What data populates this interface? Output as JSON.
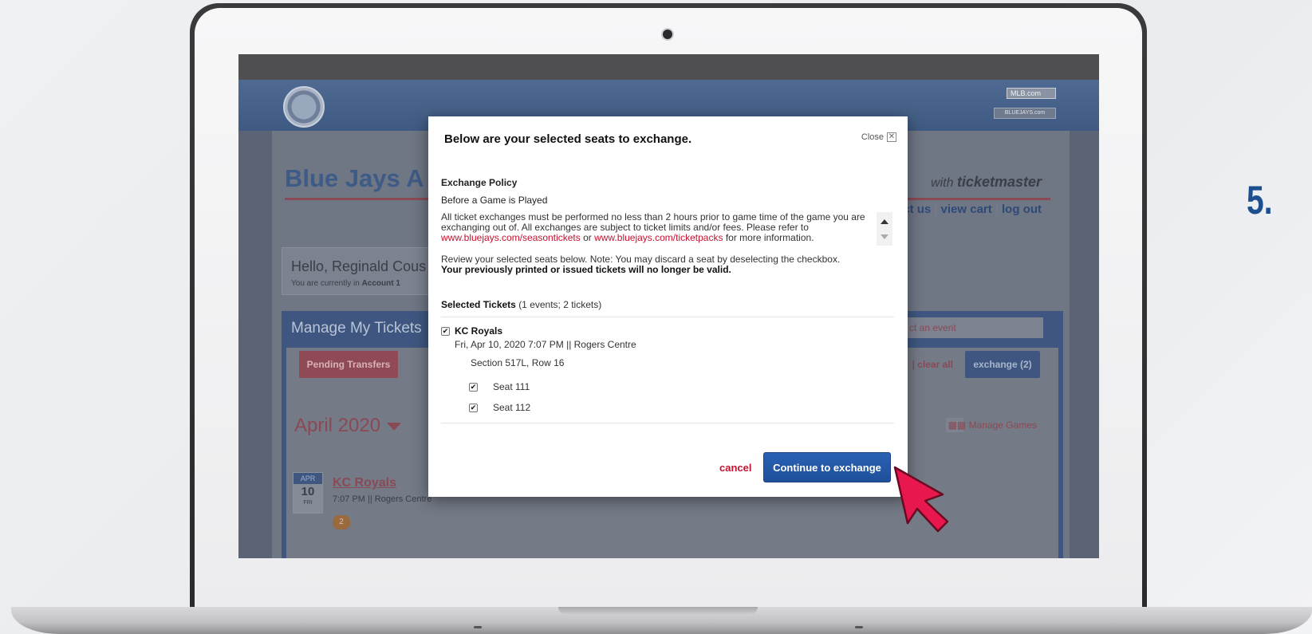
{
  "step": {
    "label": "5."
  },
  "site": {
    "mlb_badge": "MLB.com",
    "bluejays_badge": "BLUEJAYS.com",
    "page_title": "Blue Jays A",
    "with_ticketmaster_prefix": "with",
    "with_ticketmaster_brand": "ticketmaster",
    "top_links": {
      "contact": "tact us",
      "view_cart": "view cart",
      "log_out": "log out",
      "separator": "|"
    },
    "hello_name": "Hello, Reginald Cous",
    "hello_sub_prefix": "You are currently in",
    "hello_sub_account": "Account 1",
    "manage_title": "Manage My Tickets",
    "event_select_placeholder": "ct an event",
    "pending_transfers": "Pending Transfers",
    "clear_all": "| clear all",
    "exchange_button": "exchange (2)",
    "month": "April 2020",
    "manage_games": "Manage Games",
    "event": {
      "month_abbr": "APR",
      "day": "10",
      "weekday": "FRI",
      "name": "KC Royals",
      "meta": "7:07 PM || Rogers Centre",
      "count": "2"
    }
  },
  "modal": {
    "title": "Below are your selected seats to exchange.",
    "close_label": "Close",
    "close_icon": "close-x-icon",
    "policy_heading": "Exchange Policy",
    "policy_sub": "Before a Game is Played",
    "policy_text_1": "All ticket exchanges must be performed no less than 2 hours prior to game time of the game you are exchanging out of. All exchanges are subject to ticket limits and/or fees. Please refer to ",
    "policy_link_1": "www.bluejays.com/seasontickets",
    "policy_or": " or ",
    "policy_link_2": "www.bluejays.com/ticketpacks",
    "policy_text_2": " for more information.",
    "review_text": "Review your selected seats below. Note: You may discard a seat by deselecting the checkbox.",
    "review_bold": "Your previously printed or issued tickets will no longer be valid.",
    "selected_heading": "Selected Tickets",
    "selected_summary": "(1 events; 2 tickets)",
    "event_title": "KC Royals",
    "event_date": "Fri, Apr 10, 2020 7:07 PM || Rogers Centre",
    "section_row": "Section 517L, Row 16",
    "seats": [
      "Seat 111",
      "Seat 112"
    ],
    "cancel": "cancel",
    "continue": "Continue to exchange"
  },
  "colors": {
    "accent_red": "#c41230",
    "button_blue": "#1f4f99",
    "step_blue": "#1c4f8f",
    "cursor_pink": "#e8174d"
  }
}
